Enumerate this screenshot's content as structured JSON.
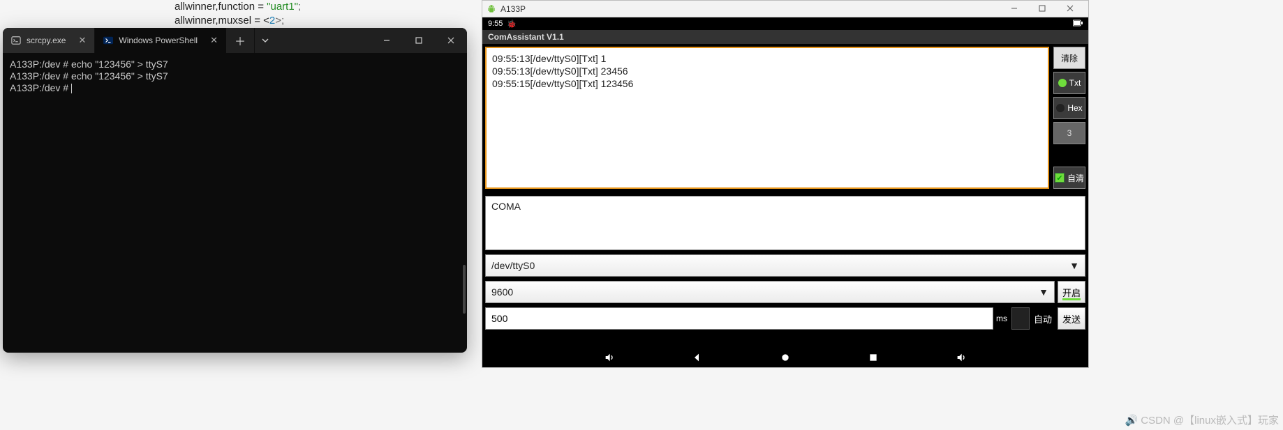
{
  "code_bg": {
    "l1_a": "allwinner,function = ",
    "l1_b": "\"uart1\"",
    "l1_c": ";",
    "l2_a": "allwinner,muxsel = <",
    "l2_b": "2",
    "l2_c": ">;"
  },
  "terminal": {
    "tabs": [
      {
        "label": "scrcpy.exe",
        "active": false
      },
      {
        "label": "Windows PowerShell",
        "active": true
      }
    ],
    "lines": [
      "A133P:/dev # echo \"123456\" > ttyS7",
      "A133P:/dev # echo \"123456\" > ttyS7",
      "A133P:/dev # "
    ]
  },
  "scrcpy": {
    "window_title": "A133P",
    "statusbar_time": "9:55",
    "app_title": "ComAssistant V1.1",
    "log_lines": [
      "09:55:13[/dev/ttyS0][Txt] 1",
      "09:55:13[/dev/ttyS0][Txt] 23456",
      "",
      "09:55:15[/dev/ttyS0][Txt] 123456"
    ],
    "side": {
      "clear": "清除",
      "txt": "Txt",
      "hex": "Hex",
      "count": "3",
      "autoclear": "自清"
    },
    "send_text": "COMA",
    "port": "/dev/ttyS0",
    "baud": "9600",
    "open_btn": "开启",
    "interval": "500",
    "interval_unit": "ms",
    "auto_label": "自动",
    "send_btn": "发送"
  },
  "watermark": "CSDN @【linux嵌入式】玩家"
}
